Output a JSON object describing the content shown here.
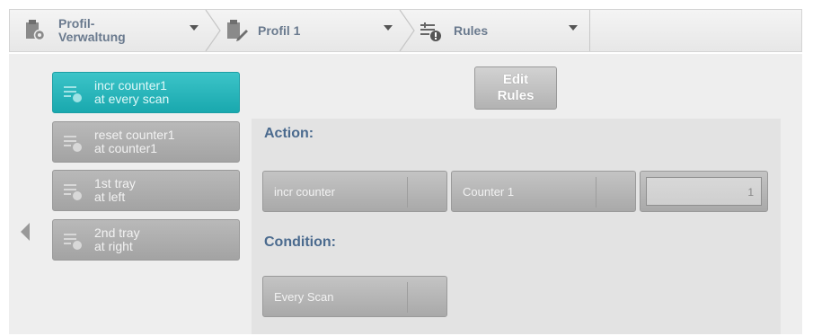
{
  "breadcrumb": {
    "items": [
      {
        "label": "Profil-\nVerwaltung",
        "icon": "profile-management-icon"
      },
      {
        "label": "Profil 1",
        "icon": "clipboard-edit-icon"
      },
      {
        "label": "Rules",
        "icon": "rules-icon"
      }
    ]
  },
  "rules": [
    {
      "line1": "incr counter1",
      "line2": "at every scan",
      "active": true,
      "icon": "rule-icon"
    },
    {
      "line1": "reset counter1",
      "line2": "at counter1",
      "active": false,
      "icon": "rule-icon"
    },
    {
      "line1": "1st tray",
      "line2": "at left",
      "active": false,
      "icon": "rule-icon"
    },
    {
      "line1": "2nd tray",
      "line2": "at right",
      "active": false,
      "icon": "rule-icon"
    }
  ],
  "edit_button": {
    "label": "Edit\nRules"
  },
  "action": {
    "heading": "Action:",
    "type_value": "incr counter",
    "counter_value": "Counter 1",
    "amount_value": "1"
  },
  "condition": {
    "heading": "Condition:",
    "value": "Every Scan"
  },
  "colors": {
    "accent": "#19a8ae",
    "heading": "#4a6a8e",
    "breadcrumb_text": "#6a7a8e"
  }
}
